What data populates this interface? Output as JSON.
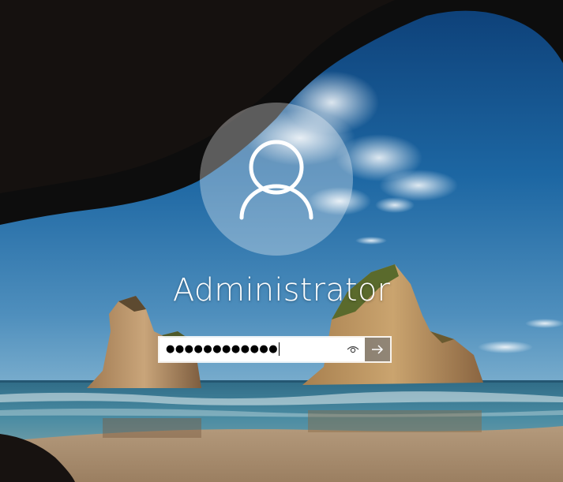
{
  "user": {
    "name": "Administrator"
  },
  "password_field": {
    "value": "●●●●●●●●●●●●"
  },
  "icons": {
    "avatar": "user-silhouette-icon",
    "reveal": "eye-icon",
    "submit": "arrow-right-icon"
  },
  "colors": {
    "text": "#ffffff",
    "input_bg": "#ffffff",
    "submit_bg": "#6e6e6e"
  }
}
